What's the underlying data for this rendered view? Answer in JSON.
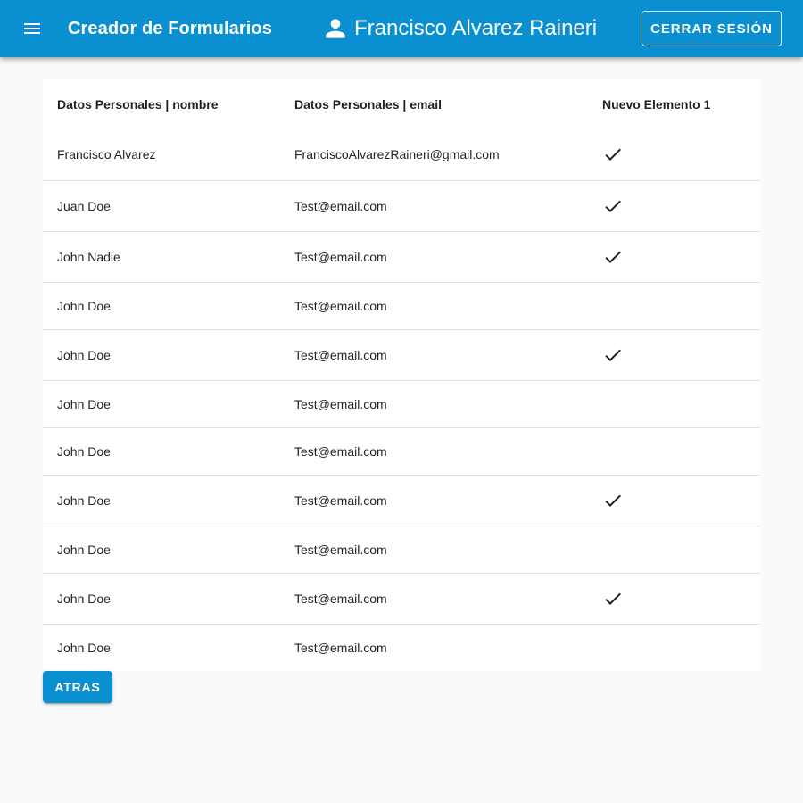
{
  "toolbar": {
    "menu_icon": "menu-icon",
    "title": "Creador de Formularios",
    "user_icon": "person-icon",
    "user_name": "Francisco Alvarez Raineri",
    "logout_label": "CERRAR SESIÓN"
  },
  "table": {
    "headers": [
      "Datos Personales | nombre",
      "Datos Personales | email",
      "Nuevo Elemento 1"
    ],
    "rows": [
      {
        "nombre": "Francisco Alvarez",
        "email": "FranciscoAlvarezRaineri@gmail.com",
        "checked": true
      },
      {
        "nombre": "Juan Doe",
        "email": "Test@email.com",
        "checked": true
      },
      {
        "nombre": "John Nadie",
        "email": "Test@email.com",
        "checked": true
      },
      {
        "nombre": "John Doe",
        "email": "Test@email.com",
        "checked": false
      },
      {
        "nombre": "John Doe",
        "email": "Test@email.com",
        "checked": true
      },
      {
        "nombre": "John Doe",
        "email": "Test@email.com",
        "checked": false
      },
      {
        "nombre": "John Doe",
        "email": "Test@email.com",
        "checked": false
      },
      {
        "nombre": "John Doe",
        "email": "Test@email.com",
        "checked": true
      },
      {
        "nombre": "John Doe",
        "email": "Test@email.com",
        "checked": false
      },
      {
        "nombre": "John Doe",
        "email": "Test@email.com",
        "checked": true
      },
      {
        "nombre": "John Doe",
        "email": "Test@email.com",
        "checked": false
      }
    ],
    "check_icon": "check-icon"
  },
  "footer": {
    "back_label": "ATRAS"
  },
  "colors": {
    "primary": "#0a8fd1",
    "background": "#fafafa"
  }
}
